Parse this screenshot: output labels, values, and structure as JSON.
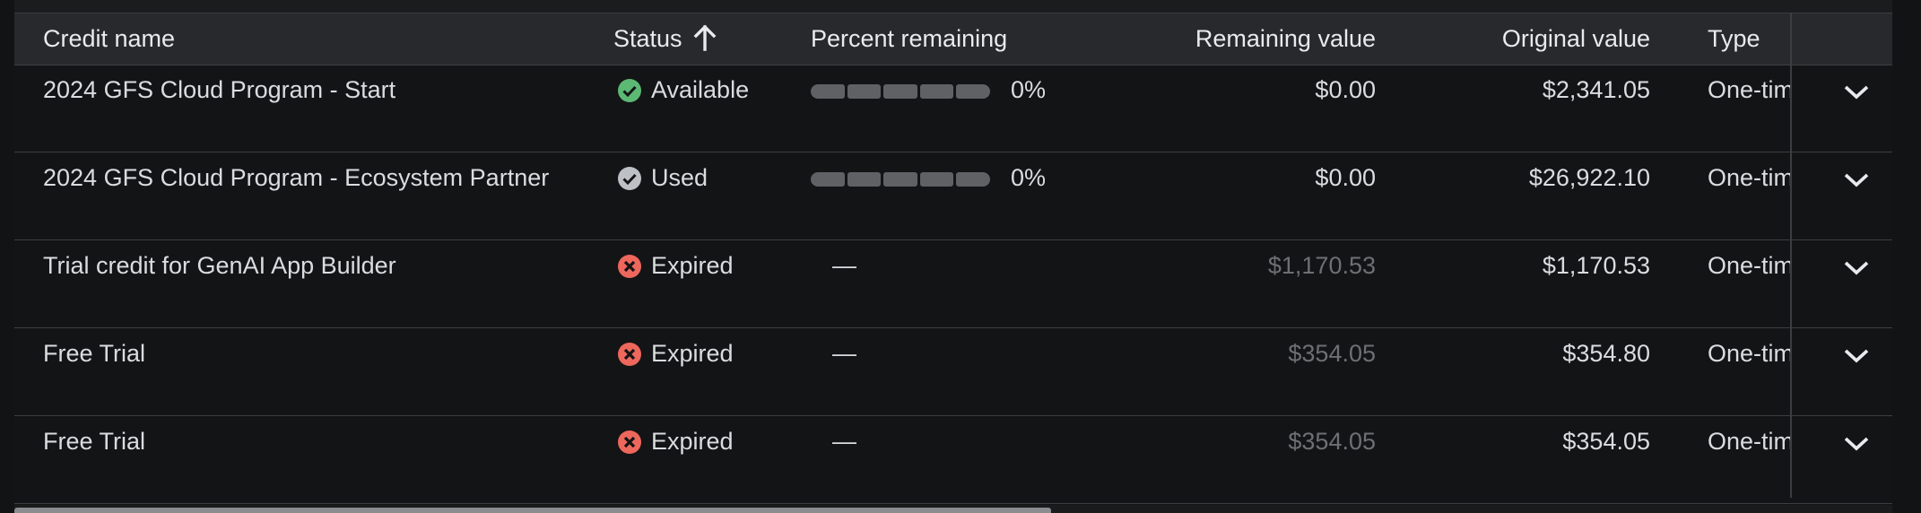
{
  "table": {
    "columns": {
      "credit_name": "Credit name",
      "status": "Status",
      "percent_remaining": "Percent remaining",
      "remaining_value": "Remaining value",
      "original_value": "Original value",
      "type": "Type"
    },
    "sort": {
      "column": "status",
      "direction": "ascending",
      "icon": "arrow-up-icon"
    },
    "rows": [
      {
        "name": "2024 GFS Cloud Program - Start",
        "status": "Available",
        "status_icon": "check-circle-green-icon",
        "percent": "0%",
        "percent_fraction": 0,
        "remaining": "$0.00",
        "remaining_dim": false,
        "original": "$2,341.05",
        "type": "One-time"
      },
      {
        "name": "2024 GFS Cloud Program - Ecosystem Partner",
        "status": "Used",
        "status_icon": "check-circle-grey-icon",
        "percent": "0%",
        "percent_fraction": 0,
        "remaining": "$0.00",
        "remaining_dim": false,
        "original": "$26,922.10",
        "type": "One-time"
      },
      {
        "name": "Trial credit for GenAI App Builder",
        "status": "Expired",
        "status_icon": "x-circle-red-icon",
        "percent": "—",
        "remaining": "$1,170.53",
        "remaining_dim": true,
        "original": "$1,170.53",
        "type": "One-time"
      },
      {
        "name": "Free Trial",
        "status": "Expired",
        "status_icon": "x-circle-red-icon",
        "percent": "—",
        "remaining": "$354.05",
        "remaining_dim": true,
        "original": "$354.80",
        "type": "One-time"
      },
      {
        "name": "Free Trial",
        "status": "Expired",
        "status_icon": "x-circle-red-icon",
        "percent": "—",
        "remaining": "$354.05",
        "remaining_dim": true,
        "original": "$354.05",
        "type": "One-time"
      }
    ]
  },
  "colors": {
    "available": "#5bb974",
    "used": "#bdc1c6",
    "expired": "#ee675c",
    "background": "#131415",
    "header": "#27292c"
  }
}
